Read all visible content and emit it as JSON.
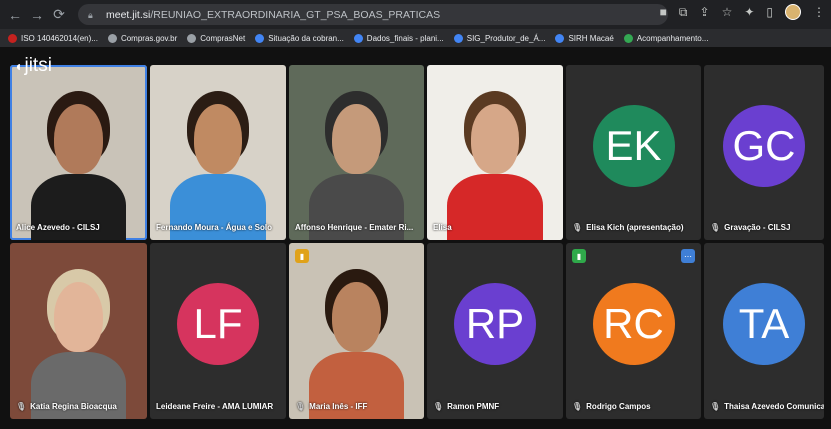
{
  "browser": {
    "url_host": "meet.jit.si",
    "url_path": "/REUNIAO_EXTRAORDINARIA_GT_PSA_BOAS_PRATICAS",
    "bookmarks": [
      {
        "label": "ISO 140462014(en)...",
        "color": "#c5221f"
      },
      {
        "label": "Compras.gov.br",
        "color": "#9aa0a6"
      },
      {
        "label": "ComprasNet",
        "color": "#9aa0a6"
      },
      {
        "label": "Situação da cobran...",
        "color": "#4285f4"
      },
      {
        "label": "Dados_finais - plani...",
        "color": "#4285f4"
      },
      {
        "label": "SIG_Produtor_de_Á...",
        "color": "#4285f4"
      },
      {
        "label": "SIRH Macaé",
        "color": "#4285f4"
      },
      {
        "label": "Acompanhamento...",
        "color": "#34a853"
      }
    ]
  },
  "meeting": {
    "logo": "jitsi",
    "tiles": [
      {
        "name": "Alice Azevedo - CILSJ",
        "muted": false,
        "type": "video"
      },
      {
        "name": "Fernando Moura - Água e Solo",
        "muted": false,
        "type": "video"
      },
      {
        "name": "Affonso Henrique - Emater Ri...",
        "muted": false,
        "type": "video"
      },
      {
        "name": "Elisa",
        "muted": false,
        "type": "video"
      },
      {
        "name": "Elisa Kich (apresentação)",
        "muted": true,
        "type": "avatar",
        "initials": "EK",
        "color": "#1f8a5c"
      },
      {
        "name": "Gravação - CILSJ",
        "muted": true,
        "type": "avatar",
        "initials": "GC",
        "color": "#6a3fd0"
      },
      {
        "name": "Katia Regina Bioacqua",
        "muted": true,
        "type": "video"
      },
      {
        "name": "Leideane Freire - AMA LUMIAR",
        "muted": false,
        "type": "avatar",
        "initials": "LF",
        "color": "#d6345e"
      },
      {
        "name": "Maria Inês - IFF",
        "muted": true,
        "type": "video"
      },
      {
        "name": "Ramon PMNF",
        "muted": true,
        "type": "avatar",
        "initials": "RP",
        "color": "#6a3fd0"
      },
      {
        "name": "Rodrigo Campos",
        "muted": true,
        "type": "avatar",
        "initials": "RC",
        "color": "#f07a1e"
      },
      {
        "name": "Thaisa Azevedo Comunicaç...",
        "muted": true,
        "type": "avatar",
        "initials": "TA",
        "color": "#3f7fd6"
      }
    ]
  }
}
